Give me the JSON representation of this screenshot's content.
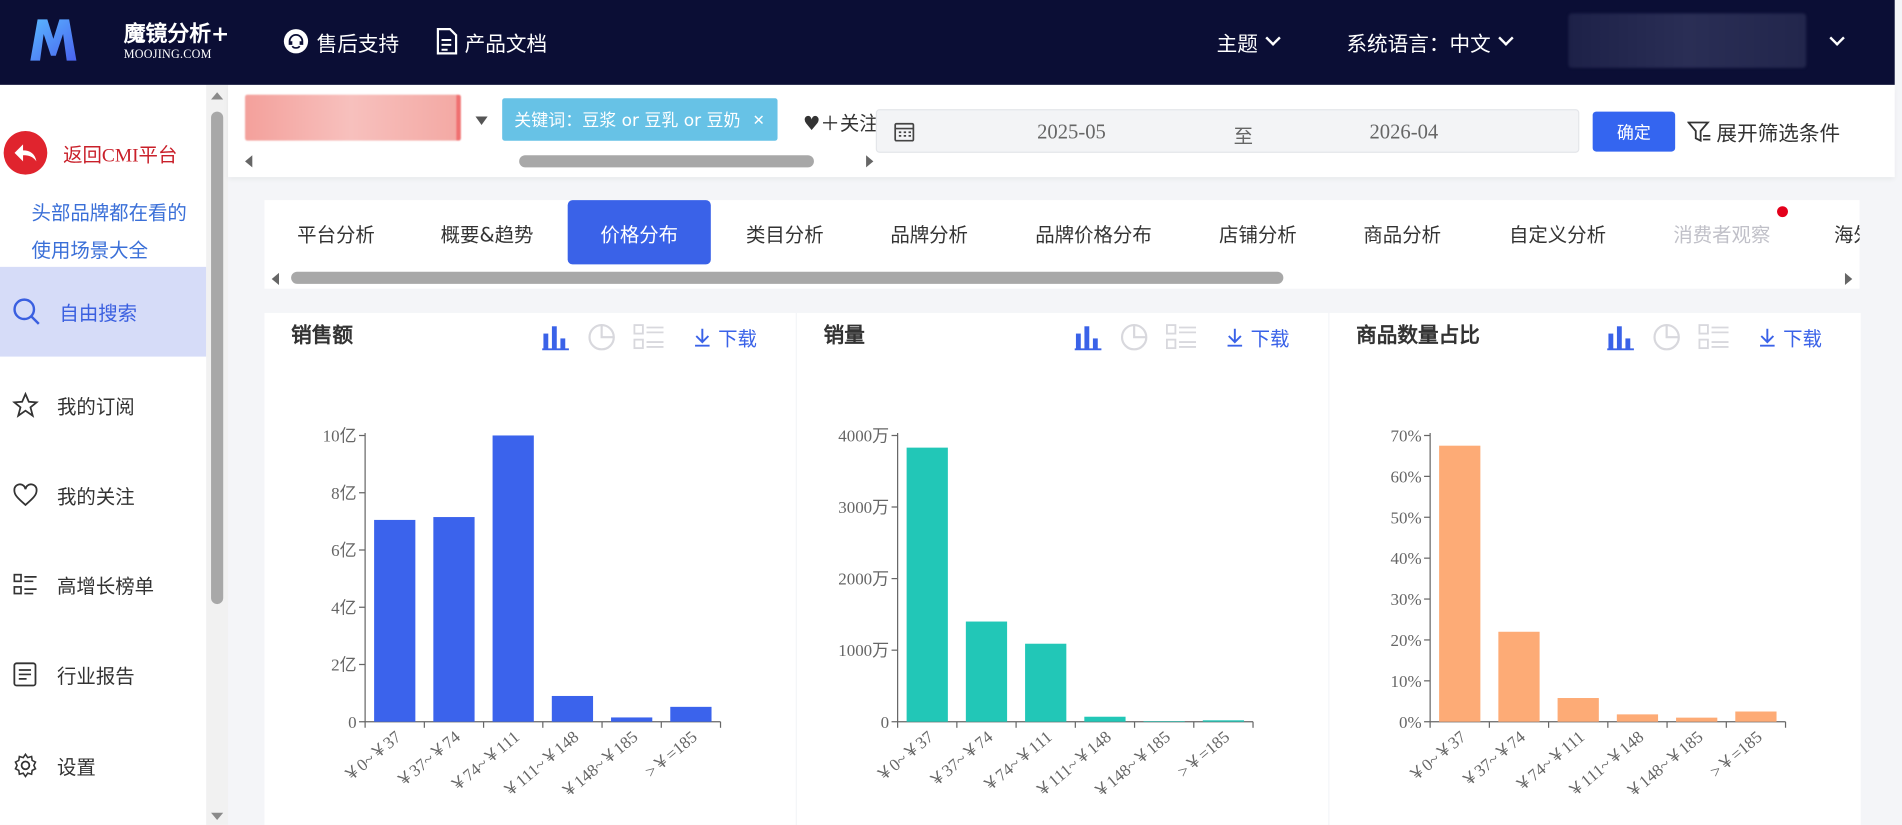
{
  "app": {
    "brand_title": "魔镜分析+",
    "brand_sub": "MOOJING.COM",
    "support": "售后支持",
    "docs": "产品文档",
    "theme": "主题",
    "language": "系统语言：中文"
  },
  "sidebar": {
    "back": "返回CMI平台",
    "promo": "头部品牌都在看的使用场景大全",
    "items": [
      {
        "label": "自由搜索",
        "icon": "search-icon"
      },
      {
        "label": "我的订阅",
        "icon": "star-icon"
      },
      {
        "label": "我的关注",
        "icon": "heart-icon"
      },
      {
        "label": "高增长榜单",
        "icon": "list-icon"
      },
      {
        "label": "行业报告",
        "icon": "report-icon"
      },
      {
        "label": "设置",
        "icon": "gear-icon"
      }
    ]
  },
  "filters": {
    "keyword_tag": "关键词：豆浆 or 豆乳 or 豆奶",
    "follow": "♥＋关注",
    "date_from": "2025-05",
    "date_sep": "至",
    "date_to": "2026-04",
    "confirm": "确定",
    "expand": "展开筛选条件"
  },
  "tabs": [
    "平台分析",
    "概要&趋势",
    "价格分布",
    "类目分析",
    "品牌分析",
    "品牌价格分布",
    "店铺分析",
    "商品分析",
    "自定义分析",
    "消费者观察",
    "海外"
  ],
  "active_tab": "价格分布",
  "download_label": "下载",
  "colors": {
    "accent": "#3a62e8",
    "bar1": "#3b63ec",
    "bar2": "#22c7b7",
    "bar3": "#fdab76"
  },
  "chart_data": [
    {
      "type": "bar",
      "title": "销售额",
      "categories": [
        "￥0~￥37",
        "￥37~￥74",
        "￥74~￥111",
        "￥111~￥148",
        "￥148~￥185",
        ">￥=185"
      ],
      "values": [
        7.05,
        7.15,
        10.0,
        0.9,
        0.15,
        0.52
      ],
      "yticks": [
        "0",
        "2亿",
        "4亿",
        "6亿",
        "8亿",
        "10亿"
      ],
      "ylim": [
        0,
        10
      ],
      "unit": "亿"
    },
    {
      "type": "bar",
      "title": "销量",
      "categories": [
        "￥0~￥37",
        "￥37~￥74",
        "￥74~￥111",
        "￥111~￥148",
        "￥148~￥185",
        ">￥=185"
      ],
      "values": [
        3830,
        1400,
        1090,
        70,
        5,
        20
      ],
      "yticks": [
        "0",
        "1000万",
        "2000万",
        "3000万",
        "4000万"
      ],
      "ylim": [
        0,
        4000
      ],
      "unit": "万"
    },
    {
      "type": "bar",
      "title": "商品数量占比",
      "categories": [
        "￥0~￥37",
        "￥37~￥74",
        "￥74~￥111",
        "￥111~￥148",
        "￥148~￥185",
        ">￥=185"
      ],
      "values": [
        67.5,
        22,
        5.8,
        1.8,
        1.0,
        2.5
      ],
      "yticks": [
        "0%",
        "10%",
        "20%",
        "30%",
        "40%",
        "50%",
        "60%",
        "70%"
      ],
      "ylim": [
        0,
        70
      ],
      "unit": "%"
    }
  ]
}
